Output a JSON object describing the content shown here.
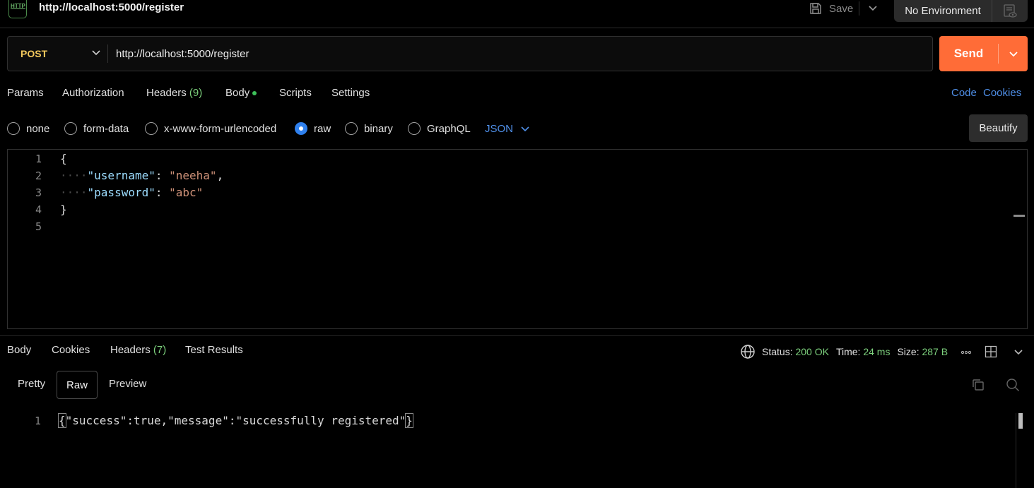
{
  "header": {
    "request_name": "http://localhost:5000/register",
    "save_label": "Save",
    "environment": "No Environment"
  },
  "request": {
    "method": "POST",
    "url": "http://localhost:5000/register",
    "send_label": "Send"
  },
  "request_tabs": {
    "params": "Params",
    "authorization": "Authorization",
    "headers": "Headers",
    "headers_count": "(9)",
    "body": "Body",
    "scripts": "Scripts",
    "settings": "Settings",
    "code": "Code",
    "cookies": "Cookies"
  },
  "body_types": {
    "none": "none",
    "form_data": "form-data",
    "urlencoded": "x-www-form-urlencoded",
    "raw": "raw",
    "binary": "binary",
    "graphql": "GraphQL",
    "selected": "raw",
    "language": "JSON",
    "beautify": "Beautify"
  },
  "editor": {
    "line_numbers": [
      "1",
      "2",
      "3",
      "4",
      "5"
    ],
    "open_brace": "{",
    "close_brace": "}",
    "indent": "····",
    "key1": "\"username\"",
    "val1": "\"neeha\"",
    "key2": "\"password\"",
    "val2": "\"abc\"",
    "colon": ": ",
    "comma": ","
  },
  "response_tabs": {
    "body": "Body",
    "cookies": "Cookies",
    "headers": "Headers",
    "headers_count": "(7)",
    "test_results": "Test Results"
  },
  "response_status": {
    "status_label": "Status:",
    "status_value": "200 OK",
    "time_label": "Time:",
    "time_value": "24 ms",
    "size_label": "Size:",
    "size_value": "287 B"
  },
  "response_view": {
    "pretty": "Pretty",
    "raw": "Raw",
    "preview": "Preview",
    "line_number": "1",
    "open_brace": "{",
    "body_text": "\"success\":true,\"message\":\"successfully registered\"",
    "close_brace": "}"
  },
  "colors": {
    "accent": "#ff6c37",
    "link": "#4f8fe8",
    "success": "#7ccf7c",
    "method": "#f4c95d"
  }
}
